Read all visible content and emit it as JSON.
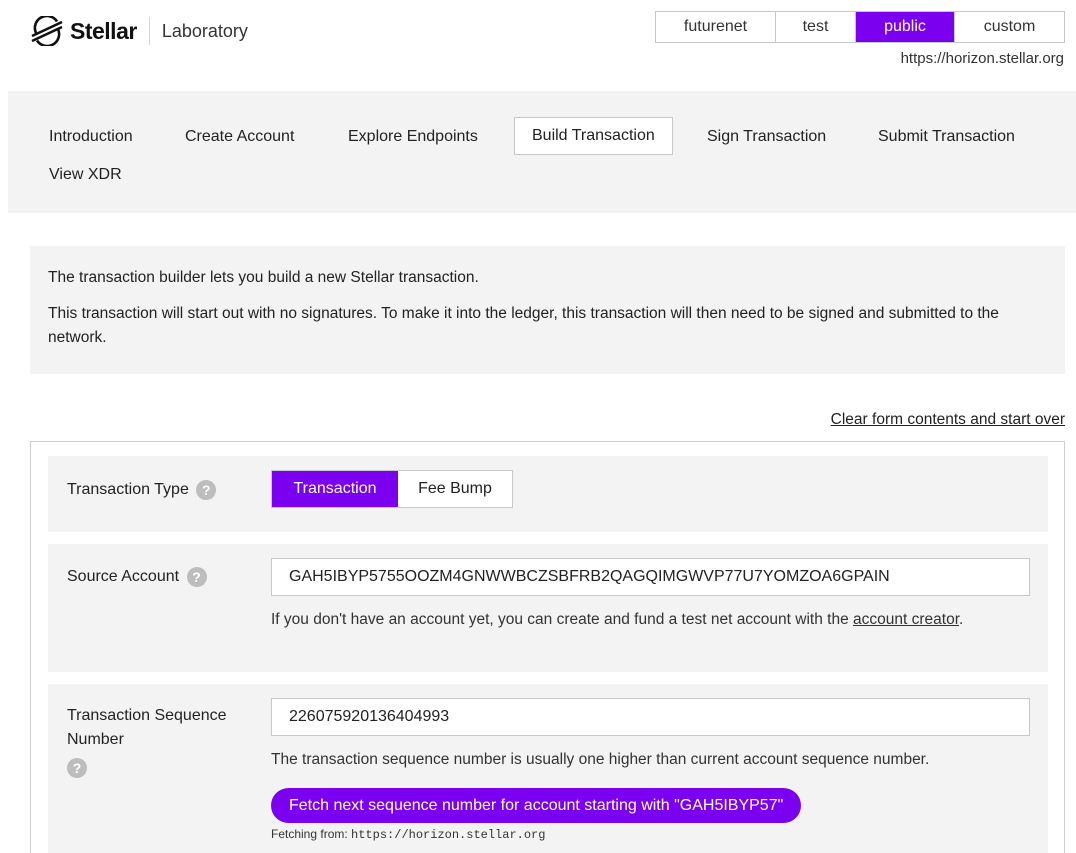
{
  "header": {
    "brand": "Stellar",
    "product": "Laboratory",
    "networks": [
      {
        "label": "futurenet",
        "active": false
      },
      {
        "label": "test",
        "active": false
      },
      {
        "label": "public",
        "active": true
      },
      {
        "label": "custom",
        "active": false
      }
    ],
    "network_url": "https://horizon.stellar.org"
  },
  "nav": {
    "items": [
      {
        "label": "Introduction"
      },
      {
        "label": "Create Account"
      },
      {
        "label": "Explore Endpoints"
      },
      {
        "label": "Build Transaction",
        "active": true
      },
      {
        "label": "Sign Transaction"
      },
      {
        "label": "Submit Transaction"
      },
      {
        "label": "View XDR"
      }
    ]
  },
  "intro": {
    "line1": "The transaction builder lets you build a new Stellar transaction.",
    "line2": "This transaction will start out with no signatures. To make it into the ledger, this transaction will then need to be signed and submitted to the network."
  },
  "clear_link": "Clear form contents and start over",
  "form": {
    "transaction_type": {
      "label": "Transaction Type",
      "options": [
        "Transaction",
        "Fee Bump"
      ],
      "selected": "Transaction"
    },
    "source_account": {
      "label": "Source Account",
      "value": "GAH5IBYP5755OOZM4GNWWBCZSBFRB2QAGQIMGWVP77U7YOMZOA6GPAIN",
      "help_prefix": "If you don't have an account yet, you can create and fund a test net account with the ",
      "help_link": "account creator",
      "help_suffix": "."
    },
    "sequence_number": {
      "label": "Transaction Sequence Number",
      "value": "226075920136404993",
      "help": "The transaction sequence number is usually one higher than current account sequence number.",
      "fetch_button": "Fetch next sequence number for account starting with \"GAH5IBYP57\"",
      "fetch_note_prefix": "Fetching from: ",
      "fetch_note_url": "https://horizon.stellar.org"
    }
  },
  "colors": {
    "accent": "#7b00f0",
    "panel": "#f3f3f3"
  }
}
